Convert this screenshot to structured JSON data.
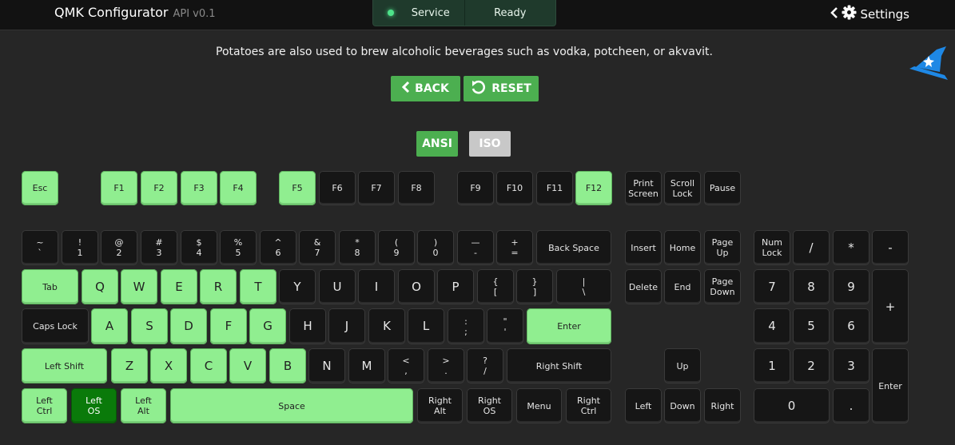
{
  "app": {
    "title": "QMK Configurator",
    "api": "API v0.1"
  },
  "status": {
    "service_label": "Service",
    "state_label": "Ready"
  },
  "settings_label": "Settings",
  "message": "Potatoes are also used to brew alcoholic beverages such as vodka, potcheen, or akvavit.",
  "buttons": {
    "back": "BACK",
    "reset": "RESET"
  },
  "layout": {
    "ansi": "ANSI",
    "iso": "ISO",
    "selected": "ANSI"
  },
  "colors": {
    "accent_green": "#4caf50",
    "key_light": "#90ee90",
    "key_dark": "#161616",
    "key_selected": "#0a7a0a",
    "wizard_blue": "#1e88e5"
  },
  "keys": [
    {
      "id": "esc",
      "label": "Esc",
      "state": "light"
    },
    {
      "id": "f1",
      "label": "F1",
      "state": "light"
    },
    {
      "id": "f2",
      "label": "F2",
      "state": "light"
    },
    {
      "id": "f3",
      "label": "F3",
      "state": "light"
    },
    {
      "id": "f4",
      "label": "F4",
      "state": "light"
    },
    {
      "id": "f5",
      "label": "F5",
      "state": "light"
    },
    {
      "id": "f6",
      "label": "F6",
      "state": "dark"
    },
    {
      "id": "f7",
      "label": "F7",
      "state": "dark"
    },
    {
      "id": "f8",
      "label": "F8",
      "state": "dark"
    },
    {
      "id": "f9",
      "label": "F9",
      "state": "dark"
    },
    {
      "id": "f10",
      "label": "F10",
      "state": "dark"
    },
    {
      "id": "f11",
      "label": "F11",
      "state": "dark"
    },
    {
      "id": "f12",
      "label": "F12",
      "state": "light"
    },
    {
      "id": "print-screen",
      "label": "Print\nScreen",
      "state": "dark"
    },
    {
      "id": "scroll-lock",
      "label": "Scroll\nLock",
      "state": "dark"
    },
    {
      "id": "pause",
      "label": "Pause",
      "state": "dark"
    },
    {
      "id": "grave",
      "label": "~\n`",
      "state": "dark"
    },
    {
      "id": "1",
      "label": "!\n1",
      "state": "dark"
    },
    {
      "id": "2",
      "label": "@\n2",
      "state": "dark"
    },
    {
      "id": "3",
      "label": "#\n3",
      "state": "dark"
    },
    {
      "id": "4",
      "label": "$\n4",
      "state": "dark"
    },
    {
      "id": "5",
      "label": "%\n5",
      "state": "dark"
    },
    {
      "id": "6",
      "label": "^\n6",
      "state": "dark"
    },
    {
      "id": "7",
      "label": "&\n7",
      "state": "dark"
    },
    {
      "id": "8",
      "label": "*\n8",
      "state": "dark"
    },
    {
      "id": "9",
      "label": "(\n9",
      "state": "dark"
    },
    {
      "id": "0",
      "label": ")\n0",
      "state": "dark"
    },
    {
      "id": "minus",
      "label": "—\n-",
      "state": "dark"
    },
    {
      "id": "equal",
      "label": "+\n=",
      "state": "dark"
    },
    {
      "id": "backspace",
      "label": "Back Space",
      "state": "dark"
    },
    {
      "id": "insert",
      "label": "Insert",
      "state": "dark"
    },
    {
      "id": "home",
      "label": "Home",
      "state": "dark"
    },
    {
      "id": "page-up",
      "label": "Page\nUp",
      "state": "dark"
    },
    {
      "id": "num-lock",
      "label": "Num\nLock",
      "state": "dark"
    },
    {
      "id": "kp-slash",
      "label": "/",
      "state": "dark"
    },
    {
      "id": "kp-star",
      "label": "*",
      "state": "dark"
    },
    {
      "id": "kp-minus",
      "label": "-",
      "state": "dark"
    },
    {
      "id": "tab",
      "label": "Tab",
      "state": "light"
    },
    {
      "id": "q",
      "label": "Q",
      "state": "light"
    },
    {
      "id": "w",
      "label": "W",
      "state": "light"
    },
    {
      "id": "e",
      "label": "E",
      "state": "light"
    },
    {
      "id": "r",
      "label": "R",
      "state": "light"
    },
    {
      "id": "t",
      "label": "T",
      "state": "light"
    },
    {
      "id": "y",
      "label": "Y",
      "state": "dark"
    },
    {
      "id": "u",
      "label": "U",
      "state": "dark"
    },
    {
      "id": "i",
      "label": "I",
      "state": "dark"
    },
    {
      "id": "o",
      "label": "O",
      "state": "dark"
    },
    {
      "id": "p",
      "label": "P",
      "state": "dark"
    },
    {
      "id": "lbracket",
      "label": "{\n[",
      "state": "dark"
    },
    {
      "id": "rbracket",
      "label": "}\n]",
      "state": "dark"
    },
    {
      "id": "backslash",
      "label": "|\n\\",
      "state": "dark"
    },
    {
      "id": "delete",
      "label": "Delete",
      "state": "dark"
    },
    {
      "id": "end",
      "label": "End",
      "state": "dark"
    },
    {
      "id": "page-down",
      "label": "Page\nDown",
      "state": "dark"
    },
    {
      "id": "kp7",
      "label": "7",
      "state": "dark"
    },
    {
      "id": "kp8",
      "label": "8",
      "state": "dark"
    },
    {
      "id": "kp9",
      "label": "9",
      "state": "dark"
    },
    {
      "id": "kp-plus",
      "label": "+",
      "state": "dark"
    },
    {
      "id": "caps-lock",
      "label": "Caps Lock",
      "state": "dark"
    },
    {
      "id": "a",
      "label": "A",
      "state": "light"
    },
    {
      "id": "s",
      "label": "S",
      "state": "light"
    },
    {
      "id": "d",
      "label": "D",
      "state": "light"
    },
    {
      "id": "f",
      "label": "F",
      "state": "light"
    },
    {
      "id": "g",
      "label": "G",
      "state": "light"
    },
    {
      "id": "h",
      "label": "H",
      "state": "dark"
    },
    {
      "id": "j",
      "label": "J",
      "state": "dark"
    },
    {
      "id": "k",
      "label": "K",
      "state": "dark"
    },
    {
      "id": "l",
      "label": "L",
      "state": "dark"
    },
    {
      "id": "semicolon",
      "label": ":\n;",
      "state": "dark"
    },
    {
      "id": "quote",
      "label": "\"\n'",
      "state": "dark"
    },
    {
      "id": "enter",
      "label": "Enter",
      "state": "light"
    },
    {
      "id": "kp4",
      "label": "4",
      "state": "dark"
    },
    {
      "id": "kp5",
      "label": "5",
      "state": "dark"
    },
    {
      "id": "kp6",
      "label": "6",
      "state": "dark"
    },
    {
      "id": "left-shift",
      "label": "Left Shift",
      "state": "light"
    },
    {
      "id": "z",
      "label": "Z",
      "state": "light"
    },
    {
      "id": "x",
      "label": "X",
      "state": "light"
    },
    {
      "id": "c",
      "label": "C",
      "state": "light"
    },
    {
      "id": "v",
      "label": "V",
      "state": "light"
    },
    {
      "id": "b",
      "label": "B",
      "state": "light"
    },
    {
      "id": "n",
      "label": "N",
      "state": "dark"
    },
    {
      "id": "m",
      "label": "M",
      "state": "dark"
    },
    {
      "id": "comma",
      "label": "<\n,",
      "state": "dark"
    },
    {
      "id": "period",
      "label": ">\n.",
      "state": "dark"
    },
    {
      "id": "slash",
      "label": "?\n/",
      "state": "dark"
    },
    {
      "id": "right-shift",
      "label": "Right Shift",
      "state": "dark"
    },
    {
      "id": "up",
      "label": "Up",
      "state": "dark"
    },
    {
      "id": "kp1",
      "label": "1",
      "state": "dark"
    },
    {
      "id": "kp2",
      "label": "2",
      "state": "dark"
    },
    {
      "id": "kp3",
      "label": "3",
      "state": "dark"
    },
    {
      "id": "kp-enter",
      "label": "Enter",
      "state": "dark"
    },
    {
      "id": "left-ctrl",
      "label": "Left\nCtrl",
      "state": "light"
    },
    {
      "id": "left-os",
      "label": "Left\nOS",
      "state": "selected"
    },
    {
      "id": "left-alt",
      "label": "Left\nAlt",
      "state": "light"
    },
    {
      "id": "space",
      "label": "Space",
      "state": "light"
    },
    {
      "id": "right-alt",
      "label": "Right\nAlt",
      "state": "dark"
    },
    {
      "id": "right-os",
      "label": "Right\nOS",
      "state": "dark"
    },
    {
      "id": "menu",
      "label": "Menu",
      "state": "dark"
    },
    {
      "id": "right-ctrl",
      "label": "Right\nCtrl",
      "state": "dark"
    },
    {
      "id": "left",
      "label": "Left",
      "state": "dark"
    },
    {
      "id": "down",
      "label": "Down",
      "state": "dark"
    },
    {
      "id": "right",
      "label": "Right",
      "state": "dark"
    },
    {
      "id": "kp0",
      "label": "0",
      "state": "dark"
    },
    {
      "id": "kp-dot",
      "label": ".",
      "state": "dark"
    }
  ]
}
